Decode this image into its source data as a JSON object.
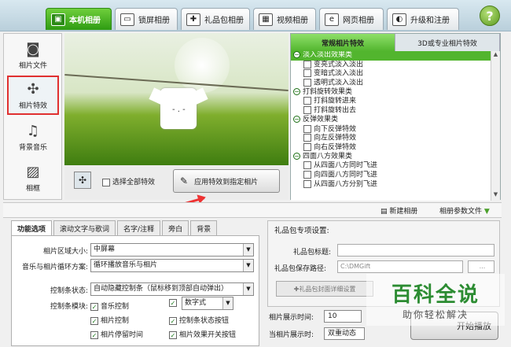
{
  "tabs": [
    {
      "label": "本机相册",
      "active": true
    },
    {
      "label": "锁屏相册"
    },
    {
      "label": "礼品包相册"
    },
    {
      "label": "视频相册"
    },
    {
      "label": "网页相册"
    },
    {
      "label": "升级和注册"
    }
  ],
  "help": "?",
  "sidebar": {
    "items": [
      {
        "label": "相片文件",
        "icon": "camera-icon"
      },
      {
        "label": "相片特效",
        "icon": "puzzle-icon",
        "selected": true
      },
      {
        "label": "背景音乐",
        "icon": "music-note-icon"
      },
      {
        "label": "相框",
        "icon": "picture-frame-icon"
      }
    ]
  },
  "preview": {
    "face": "- . -"
  },
  "controls": {
    "select_all": "选择全部特效",
    "apply": "应用特效到指定相片"
  },
  "effects": {
    "tabs": [
      "常规相片特效",
      "3D或专业相片特效"
    ],
    "rows": [
      {
        "type": "cat",
        "label": "淡入淡出效果类"
      },
      {
        "type": "item",
        "label": "变亮式淡入淡出"
      },
      {
        "type": "item",
        "label": "变暗式淡入淡出"
      },
      {
        "type": "item",
        "label": "透明式淡入淡出"
      },
      {
        "type": "cat2",
        "label": "打斜旋转效果类"
      },
      {
        "type": "item",
        "label": "打斜旋转进来"
      },
      {
        "type": "item",
        "label": "打斜旋转出去"
      },
      {
        "type": "cat2",
        "label": "反弹效果类"
      },
      {
        "type": "item",
        "label": "向下反弹特效"
      },
      {
        "type": "item",
        "label": "向左反弹特效"
      },
      {
        "type": "item",
        "label": "向右反弹特效"
      },
      {
        "type": "cat2",
        "label": "四面八方效果类"
      },
      {
        "type": "item",
        "label": "从四面八方同时飞进"
      },
      {
        "type": "item",
        "label": "向四面八方同时飞进"
      },
      {
        "type": "item",
        "label": "从四面八方分别飞进"
      }
    ]
  },
  "toolbar2": {
    "new_album": "新建相册",
    "album_settings": "相册参数文件"
  },
  "options": {
    "tabs": [
      "功能选项",
      "滚动文字与歌词",
      "名字/注释",
      "旁白",
      "背景"
    ],
    "size_label": "相片区域大小:",
    "size_value": "中屏幕",
    "loop_label": "音乐与相片循环方案:",
    "loop_value": "循环播放音乐与相片",
    "ctrlbar_label": "控制条状态:",
    "ctrlbar_value": "自动隐藏控制条（鼠标移到顶部自动弹出）",
    "module_label": "控制条模块:",
    "checks": [
      "音乐控制",
      "数字式",
      "相片控制",
      "控制条状态按钮",
      "相片停留时间",
      "相片效果开关按钮"
    ]
  },
  "gift": {
    "title": "礼品包专项设置:",
    "title_label": "礼品包标题:",
    "path_label": "礼品包保存路径:",
    "path_value": "C:\\DMGift",
    "browse": "...",
    "cover_btn": "礼品包封面详细设置"
  },
  "bottom": {
    "time_label": "相片展示时间:",
    "time_value": "10",
    "mode_label": "当相片展示时:",
    "mode_value": "双重动态",
    "play": "开始播放"
  },
  "watermark": {
    "big": "百科全说",
    "small": "助你轻松解决"
  }
}
